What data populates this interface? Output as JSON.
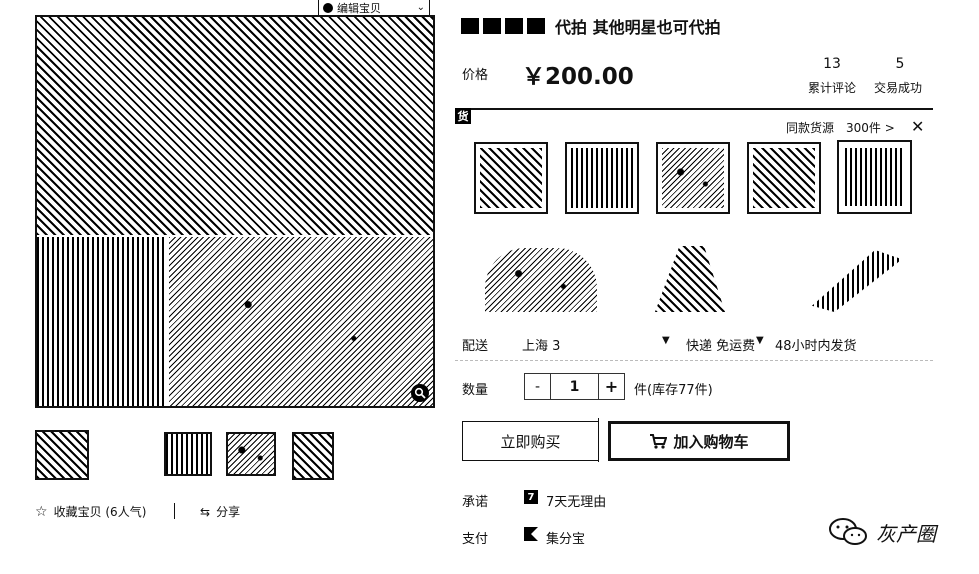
{
  "product": {
    "title_redacted": "▬▬▬",
    "title_suffix": "代拍 其他明星也可代拍",
    "price_label": "价格",
    "price_value": "￥200.00",
    "reviews_count": "13",
    "reviews_label": "累计评论",
    "trades_count": "5",
    "trades_label": "交易成功"
  },
  "gallery": {
    "top_badge": "编辑宝贝",
    "zoom_icon": "magnifier-icon",
    "thumbnails_count": 4
  },
  "actions": {
    "favorite_label": "收藏宝贝 (6人气)",
    "share_label": "分享"
  },
  "sources": {
    "badge": "货",
    "same_source_label": "同款货源",
    "count_label": "300件 >",
    "close_icon": "close-icon"
  },
  "delivery": {
    "label": "配送",
    "from": "上海 3",
    "shipping": "快递 免运费",
    "dispatch": "48小时内发货"
  },
  "quantity": {
    "label": "数量",
    "minus": "-",
    "value": "1",
    "plus": "+",
    "stock": "件(库存77件)"
  },
  "buttons": {
    "buy_now": "立即购买",
    "add_cart": "加入购物车"
  },
  "promise": {
    "label": "承诺",
    "badge": "7",
    "text": "7天无理由"
  },
  "payment": {
    "label": "支付",
    "text": "集分宝"
  },
  "watermark": {
    "text": "灰产圈"
  }
}
